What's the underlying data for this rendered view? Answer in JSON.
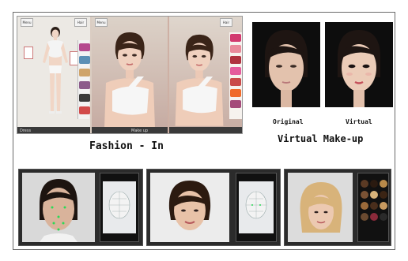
{
  "captions": {
    "fashion": "Fashion - In",
    "makeup": "Virtual Make-up",
    "original": "Original",
    "virtual": "Virtual"
  },
  "fashion_ui": {
    "toolbar": [
      "Menu",
      "Hair"
    ],
    "bottom_bar": [
      "Dress",
      "Make up"
    ]
  },
  "colors": {
    "frame_border": "#6a6a6a",
    "shop_wall": "#d8c9bd",
    "toolbar_dark": "#3a3a3a"
  },
  "icons": [
    "avatar-figure",
    "face-model",
    "hair-thumbnails"
  ]
}
